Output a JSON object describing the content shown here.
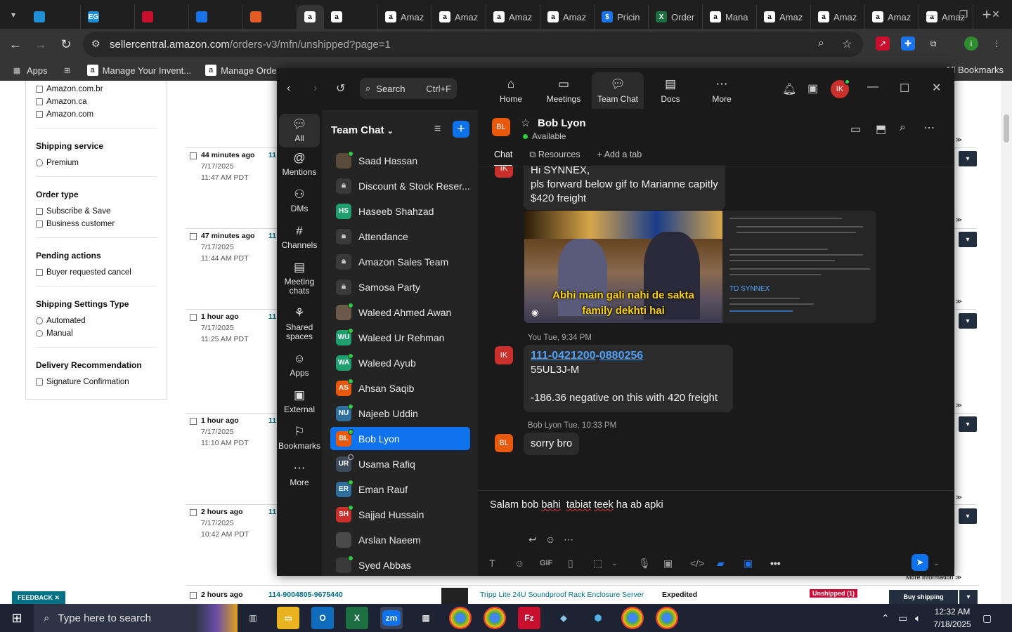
{
  "browser": {
    "tabs": [
      {
        "label": "",
        "icon": "ms-icon",
        "color": "#1f8fd6"
      },
      {
        "label": "",
        "icon": "eg-icon",
        "color": "#1f8fd6"
      },
      {
        "label": "",
        "icon": "dell-icon",
        "color": "#c8102e"
      },
      {
        "label": "",
        "icon": "g-icon",
        "color": "#1a73e8"
      },
      {
        "label": "",
        "icon": "box-icon",
        "color": "#e45d25"
      },
      {
        "label": "",
        "icon": "amazon-icon",
        "color": "#ffffff"
      },
      {
        "label": "",
        "icon": "amazon-icon",
        "color": "#ffffff"
      },
      {
        "label": "Amaz",
        "icon": "amazon-icon",
        "color": "#ffffff"
      },
      {
        "label": "Amaz",
        "icon": "amazon-icon",
        "color": "#ffffff"
      },
      {
        "label": "Amaz",
        "icon": "amazon-icon",
        "color": "#ffffff"
      },
      {
        "label": "Amaz",
        "icon": "amazon-icon",
        "color": "#ffffff"
      },
      {
        "label": "Pricin",
        "icon": "pricing-icon",
        "color": "#1a73e8"
      },
      {
        "label": "Order",
        "icon": "excel-icon",
        "color": "#1d6f42"
      },
      {
        "label": "Mana",
        "icon": "amazon-icon",
        "color": "#ffffff"
      },
      {
        "label": "Amaz",
        "icon": "amazon-icon",
        "color": "#ffffff"
      },
      {
        "label": "Amaz",
        "icon": "amazon-icon",
        "color": "#ffffff"
      },
      {
        "label": "Amaz",
        "icon": "amazon-icon",
        "color": "#ffffff"
      },
      {
        "label": "Amaz",
        "icon": "amazon-icon",
        "color": "#ffffff"
      }
    ],
    "url_host": "sellercentral.amazon.com",
    "url_path": "/orders-v3/mfn/unshipped?page=1",
    "bookmarks": {
      "apps": "Apps",
      "b1": "Manage Your Invent...",
      "b2": "Manage Orders",
      "all": "All Bookmarks"
    }
  },
  "amazon": {
    "markets": [
      "Amazon.com.br",
      "Amazon.ca",
      "Amazon.com"
    ],
    "shipping_service": {
      "title": "Shipping service",
      "options": [
        "Premium"
      ]
    },
    "order_type": {
      "title": "Order type",
      "options": [
        "Subscribe & Save",
        "Business customer"
      ]
    },
    "pending": {
      "title": "Pending actions",
      "options": [
        "Buyer requested cancel"
      ]
    },
    "ship_settings": {
      "title": "Shipping Settings Type",
      "options": [
        "Automated",
        "Manual"
      ]
    },
    "delivery": {
      "title": "Delivery Recommendation",
      "options": [
        "Signature Confirmation"
      ]
    },
    "feedback": "FEEDBACK ✕",
    "rows": [
      {
        "ago": "44 minutes ago",
        "date": "7/17/2025",
        "time": "11:47 AM PDT",
        "ord": "11"
      },
      {
        "ago": "47 minutes ago",
        "date": "7/17/2025",
        "time": "11:44 AM PDT",
        "ord": "11"
      },
      {
        "ago": "1 hour ago",
        "date": "7/17/2025",
        "time": "11:25 AM PDT",
        "ord": "11"
      },
      {
        "ago": "1 hour ago",
        "date": "7/17/2025",
        "time": "11:10 AM PDT",
        "ord": "11"
      },
      {
        "ago": "2 hours ago",
        "date": "7/17/2025",
        "time": "10:42 AM PDT",
        "ord": "11"
      }
    ],
    "last_row": {
      "ago": "2 hours ago",
      "order": "114-9004805-9675440",
      "product": "Tripp Lite 24U Soundproof Rack Enclosure Server",
      "service": "Expedited",
      "badge": "Unshipped (1)",
      "buy": "Buy shipping",
      "more_info": "More information ≫"
    }
  },
  "zoom": {
    "search": {
      "label": "Search",
      "shortcut": "Ctrl+F"
    },
    "nav": [
      "Home",
      "Meetings",
      "Team Chat",
      "Docs",
      "More"
    ],
    "user_initials": "IK",
    "rail": [
      "All",
      "Mentions",
      "DMs",
      "Channels",
      "Meeting chats",
      "Shared spaces",
      "Apps",
      "External",
      "Bookmarks",
      "More"
    ],
    "list_title": "Team Chat",
    "contacts": [
      {
        "name": "Saad Hassan",
        "initials": "",
        "color": "#5a4a3a",
        "status": "on"
      },
      {
        "name": "Discount & Stock Reser...",
        "initials": "🔒",
        "color": "#3a3a3a",
        "status": "none"
      },
      {
        "name": "Haseeb Shahzad",
        "initials": "HS",
        "color": "#1f9e6e",
        "status": "none"
      },
      {
        "name": "Attendance",
        "initials": "🔒",
        "color": "#3a3a3a",
        "status": "none"
      },
      {
        "name": "Amazon Sales Team",
        "initials": "🔒",
        "color": "#3a3a3a",
        "status": "none"
      },
      {
        "name": "Samosa Party",
        "initials": "🔒",
        "color": "#3a3a3a",
        "status": "none"
      },
      {
        "name": "Waleed Ahmed Awan",
        "initials": "",
        "color": "#6b5a4a",
        "status": "on"
      },
      {
        "name": "Waleed Ur Rehman",
        "initials": "WU",
        "color": "#1f9e6e",
        "status": "on"
      },
      {
        "name": "Waleed Ayub",
        "initials": "WA",
        "color": "#1f9e6e",
        "status": "on"
      },
      {
        "name": "Ahsan Saqib",
        "initials": "AS",
        "color": "#e8590c",
        "status": "on"
      },
      {
        "name": "Najeeb Uddin",
        "initials": "NU",
        "color": "#2f6f9e",
        "status": "on"
      },
      {
        "name": "Bob Lyon",
        "initials": "BL",
        "color": "#e8590c",
        "status": "on"
      },
      {
        "name": "Usama Rafiq",
        "initials": "UR",
        "color": "#3d4a5c",
        "status": "off"
      },
      {
        "name": "Eman Rauf",
        "initials": "ER",
        "color": "#2f6f9e",
        "status": "on"
      },
      {
        "name": "Sajjad Hussain",
        "initials": "SH",
        "color": "#c9302c",
        "status": "on"
      },
      {
        "name": "Arslan Naeem",
        "initials": "",
        "color": "#4a4a4a",
        "status": "none"
      },
      {
        "name": "Syed Abbas",
        "initials": "",
        "color": "#3a3a3a",
        "status": "on"
      }
    ],
    "chat": {
      "name": "Bob Lyon",
      "initials": "BL",
      "status": "Available",
      "tabs": [
        "Chat",
        "Resources",
        "Add a tab"
      ],
      "msg1": {
        "initials": "IK",
        "lines": [
          "Hi SYNNEX,",
          "pls forward  below gif to Marianne capitly",
          "$420 freight"
        ]
      },
      "gif_caption": [
        "Abhi main gali nahi de sakta",
        "family dekhti hai"
      ],
      "gif_doc_title": "TD SYNNEX",
      "meta2": "You Tue, 9:34 PM",
      "msg2": {
        "initials": "IK",
        "link_a": "111-0421200",
        "link_sep": "-",
        "link_b": "0880256",
        "line2": "55UL3J-M",
        "line3": "-186.36 negative  on this  with 420 freight"
      },
      "meta3": "Bob Lyon Tue, 10:33 PM",
      "msg3": {
        "initials": "BL",
        "text": "sorry bro"
      },
      "draft": {
        "a": "Salam bob ",
        "b": "bahi",
        "c": "  ",
        "d": "tabiat",
        "e": " ",
        "f": "teek",
        "g": " ha ab ",
        "h": "apki"
      }
    }
  },
  "taskbar": {
    "search_placeholder": "Type here to search",
    "time": "12:32 AM",
    "date": "7/18/2025"
  }
}
